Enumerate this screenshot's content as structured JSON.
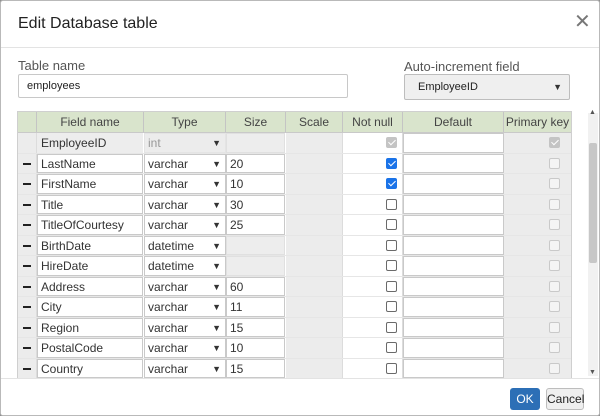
{
  "dialog": {
    "title": "Edit Database table",
    "close_icon": "close-icon"
  },
  "table_name": {
    "label": "Table name",
    "value": "employees"
  },
  "auto_increment": {
    "label": "Auto-increment field",
    "value": "EmployeeID"
  },
  "grid": {
    "headers": {
      "field_name": "Field name",
      "type": "Type",
      "size": "Size",
      "scale": "Scale",
      "not_null": "Not null",
      "default": "Default",
      "primary_key": "Primary key"
    },
    "rows": [
      {
        "name": "EmployeeID",
        "type": "int",
        "size": "",
        "not_null": true,
        "primary_key": true,
        "locked": true
      },
      {
        "name": "LastName",
        "type": "varchar",
        "size": "20",
        "not_null": true,
        "primary_key": false
      },
      {
        "name": "FirstName",
        "type": "varchar",
        "size": "10",
        "not_null": true,
        "primary_key": false
      },
      {
        "name": "Title",
        "type": "varchar",
        "size": "30",
        "not_null": false,
        "primary_key": false
      },
      {
        "name": "TitleOfCourtesy",
        "type": "varchar",
        "size": "25",
        "not_null": false,
        "primary_key": false
      },
      {
        "name": "BirthDate",
        "type": "datetime",
        "size": "",
        "not_null": false,
        "primary_key": false
      },
      {
        "name": "HireDate",
        "type": "datetime",
        "size": "",
        "not_null": false,
        "primary_key": false
      },
      {
        "name": "Address",
        "type": "varchar",
        "size": "60",
        "not_null": false,
        "primary_key": false
      },
      {
        "name": "City",
        "type": "varchar",
        "size": "11",
        "not_null": false,
        "primary_key": false
      },
      {
        "name": "Region",
        "type": "varchar",
        "size": "15",
        "not_null": false,
        "primary_key": false
      },
      {
        "name": "PostalCode",
        "type": "varchar",
        "size": "10",
        "not_null": false,
        "primary_key": false
      },
      {
        "name": "Country",
        "type": "varchar",
        "size": "15",
        "not_null": false,
        "primary_key": false
      }
    ]
  },
  "buttons": {
    "ok": "OK",
    "cancel": "Cancel"
  }
}
